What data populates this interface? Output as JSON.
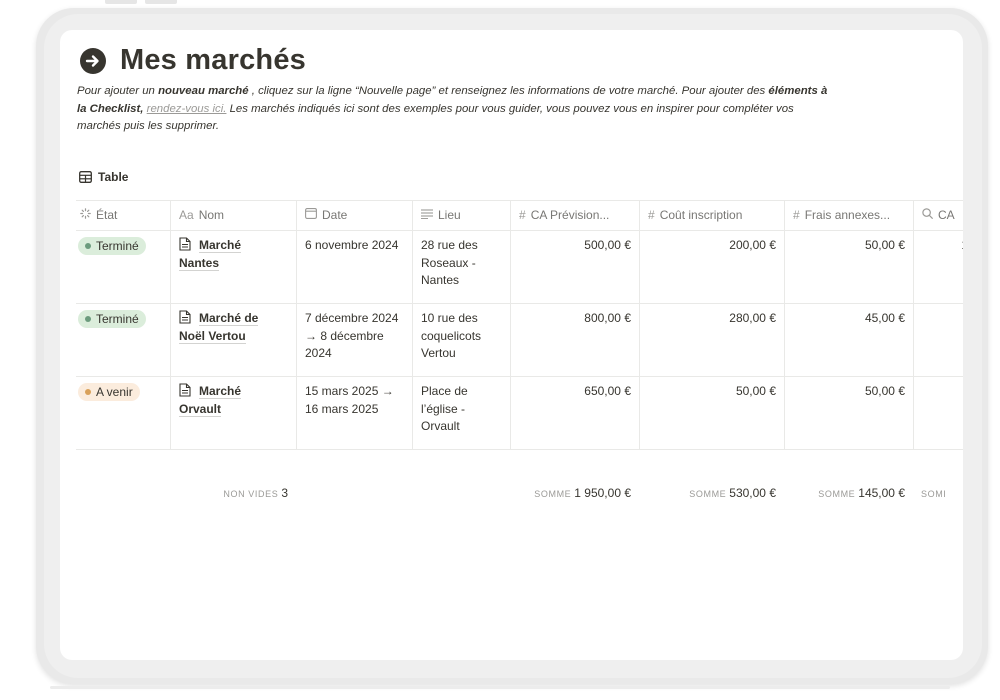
{
  "page": {
    "title": "Mes marchés",
    "description": {
      "p1": "Pour ajouter un ",
      "p1b": "nouveau marché",
      "p2": " , cliquez sur la ligne “Nouvelle page” et renseignez les informations de votre marché. Pour ajouter des ",
      "p2b": "éléments à la Checklist,",
      "p3": " ",
      "link": "rendez-vous ici.",
      "p4": "  Les marchés indiqués ici sont des exemples pour vous guider, vous pouvez vous en inspirer pour compléter vos marchés puis les supprimer."
    }
  },
  "view": {
    "label": "Table"
  },
  "columns": [
    {
      "label": "État",
      "icon": "status-icon"
    },
    {
      "label": "Nom",
      "icon_text": "Aa",
      "icon": "title-icon"
    },
    {
      "label": "Date",
      "icon": "calendar-icon"
    },
    {
      "label": "Lieu",
      "icon": "text-lines-icon"
    },
    {
      "label": "CA Prévision...",
      "icon_text": "#",
      "icon": "number-icon"
    },
    {
      "label": "Coût inscription",
      "icon_text": "#",
      "icon": "number-icon"
    },
    {
      "label": "Frais annexes...",
      "icon_text": "#",
      "icon": "number-icon"
    },
    {
      "label": "CA",
      "icon": "search-icon"
    }
  ],
  "rows": [
    {
      "status": "Terminé",
      "status_color": "#dbeddb",
      "dot_color": "#6c9b7d",
      "name_l1": "Marché",
      "name_l2": "Nantes",
      "date": "6 novembre 2024",
      "lieu": "28 rue des Roseaux - Nantes",
      "ca_prev": "500,00 €",
      "cout": "200,00 €",
      "frais": "50,00 €",
      "ca": "1"
    },
    {
      "status": "Terminé",
      "status_color": "#dbeddb",
      "dot_color": "#6c9b7d",
      "name_l1": "Marché de",
      "name_l2": "Noël Vertou",
      "date": "7 décembre 2024 → 8 décembre 2024",
      "lieu": "10 rue des coquelicots Vertou",
      "ca_prev": "800,00 €",
      "cout": "280,00 €",
      "frais": "45,00 €",
      "ca": ""
    },
    {
      "status": "A venir",
      "status_color": "#fbecdd",
      "dot_color": "#d9a15a",
      "name_l1": "Marché",
      "name_l2": "Orvault",
      "date": "15 mars 2025 → 16 mars 2025",
      "lieu": "Place de l’église - Orvault",
      "ca_prev": "650,00 €",
      "cout": "50,00 €",
      "frais": "50,00 €",
      "ca": ""
    }
  ],
  "footer": {
    "count_label": "NON VIDES",
    "count_value": "3",
    "sum_label": "SOMME",
    "sum_ca_prev": "1 950,00 €",
    "sum_cout": "530,00 €",
    "sum_frais": "145,00 €",
    "sum_ca_label": "SOMI"
  }
}
